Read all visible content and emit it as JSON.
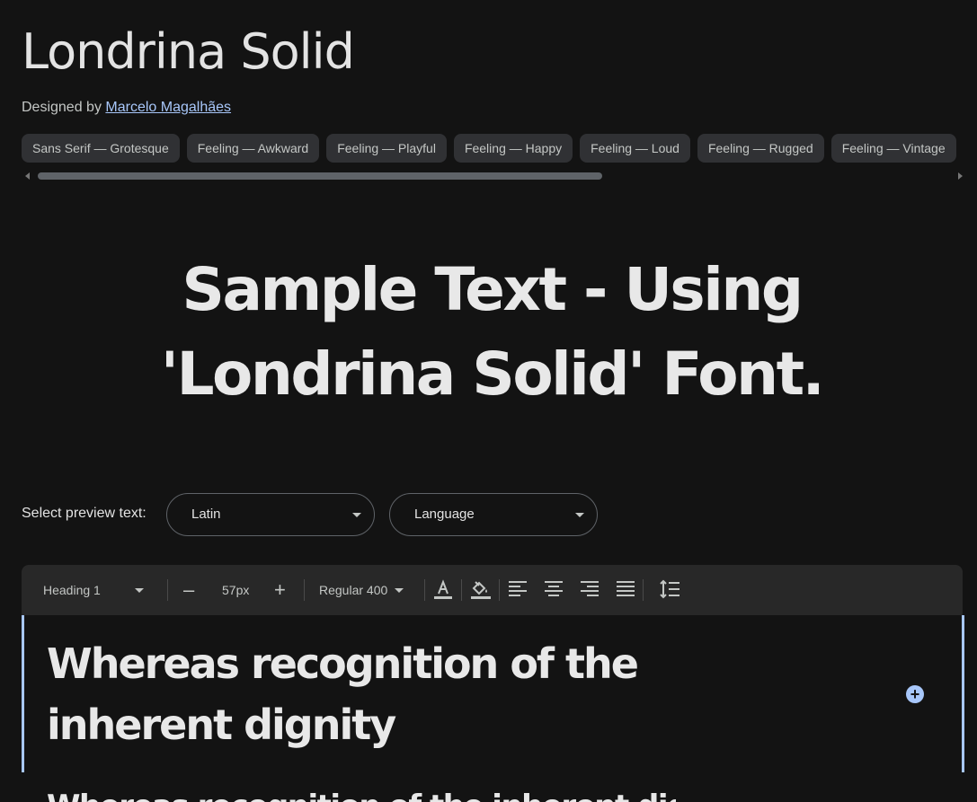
{
  "font": {
    "name": "Londrina Solid",
    "designed_by_label": "Designed by",
    "designer": "Marcelo Magalhães"
  },
  "tags": [
    "Sans Serif — Grotesque",
    "Feeling — Awkward",
    "Feeling — Playful",
    "Feeling — Happy",
    "Feeling — Loud",
    "Feeling — Rugged",
    "Feeling — Vintage"
  ],
  "sample_text": "Sample Text - Using 'Londrina Solid' Font.",
  "preview": {
    "label": "Select preview text:",
    "script_value": "Latin",
    "language_value": "Language"
  },
  "toolbar": {
    "style_value": "Heading 1",
    "decrease": "–",
    "size_value": "57px",
    "increase": "+",
    "weight_value": "Regular 400"
  },
  "editor": {
    "text": "Whereas recognition of the inherent dignity",
    "next_text": "Whereas recognition of the inherent dignity"
  },
  "colors": {
    "background": "#131313",
    "accent": "#a8c7fa",
    "chip": "#303134",
    "toolbar": "#282828"
  }
}
